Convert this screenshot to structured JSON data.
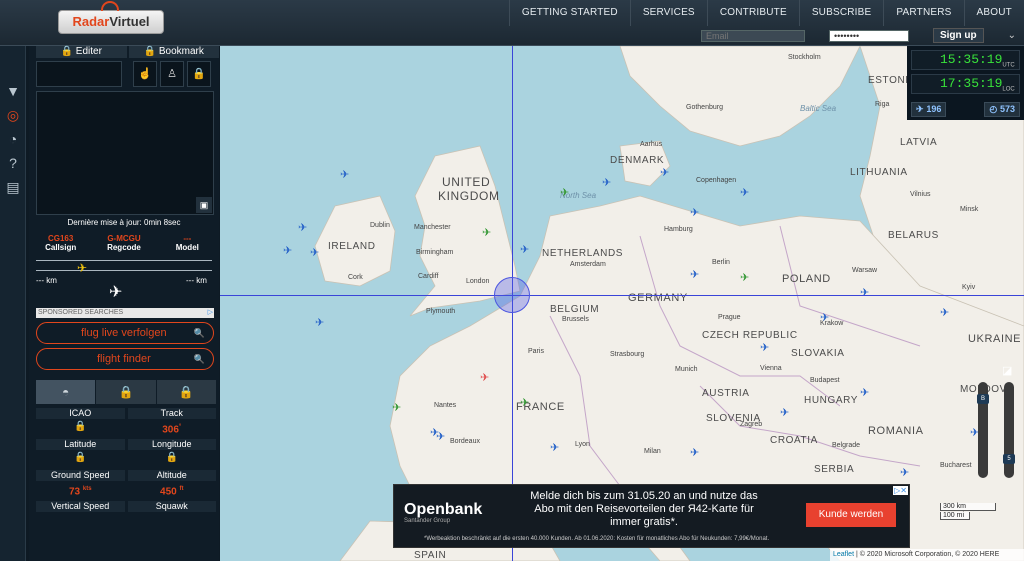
{
  "header": {
    "logo_a": "Radar",
    "logo_b": "Virtuel",
    "nav": [
      "GETTING STARTED",
      "SERVICES",
      "CONTRIBUTE",
      "SUBSCRIBE",
      "PARTNERS",
      "ABOUT"
    ],
    "email_placeholder": "Email",
    "password_value": "••••••••",
    "signup_label": "Sign up",
    "expand_icon": "double-chevron-down-icon"
  },
  "left_strip": {
    "icons": [
      "filter-icon",
      "radar-target-icon",
      "radar-sweep-icon",
      "help-icon",
      "chat-icon"
    ]
  },
  "panel": {
    "edit_label": "Editer",
    "bookmark_label": "Bookmark",
    "last_update": "Dernière mise à jour: 0min 8sec",
    "callsign_value": "CG163",
    "callsign_label": "Callsign",
    "regcode_value": "G-MCGU",
    "regcode_label": "Regcode",
    "model_value": "---",
    "model_label": "Model",
    "dist_left": "--- km",
    "dist_right": "--- km",
    "sponsored": "SPONSORED SEARCHES",
    "search1": "flug live verfolgen",
    "search2": "flight finder",
    "icao_label": "ICAO",
    "track_label": "Track",
    "track_value": "306",
    "track_unit": "°",
    "lat_label": "Latitude",
    "lon_label": "Longitude",
    "gs_label": "Ground Speed",
    "gs_value": "73",
    "gs_unit": "kts",
    "alt_label": "Altitude",
    "alt_value": "450",
    "alt_unit": "ft",
    "vs_label": "Vertical Speed",
    "squawk_label": "Squawk"
  },
  "clock": {
    "utc_time": "15:35:19",
    "utc_label": "UTC",
    "loc_time": "17:35:19",
    "loc_label": "LOC",
    "flights": "196",
    "aircraft": "573"
  },
  "map": {
    "countries": [
      "ESTONIA",
      "LATVIA",
      "LITHUANIA",
      "BELARUS",
      "UNITED",
      "KINGDOM",
      "IRELAND",
      "DENMARK",
      "NETHERLANDS",
      "BELGIUM",
      "GERMANY",
      "POLAND",
      "CZECH REPUBLIC",
      "SLOVAKIA",
      "UKRAINE",
      "AUSTRIA",
      "HUNGARY",
      "MOLDOVA",
      "FRANCE",
      "SLOVENIA",
      "CROATIA",
      "ROMANIA",
      "SERBIA",
      "SPAIN"
    ],
    "seas": [
      "Baltic Sea",
      "North Sea"
    ],
    "cities": [
      "Stockholm",
      "Gothenburg",
      "Riga",
      "Copenhagen",
      "Aarhus",
      "Vilnius",
      "Minsk",
      "Manchester",
      "Birmingham",
      "London",
      "Dublin",
      "Amsterdam",
      "Hamburg",
      "Berlin",
      "Warsaw",
      "Brussels",
      "Paris",
      "Prague",
      "Munich",
      "Vienna",
      "Budapest",
      "Krakow",
      "Kyiv",
      "Lyon",
      "Milan",
      "Bucharest",
      "Belgrade",
      "Zagreb",
      "Plymouth",
      "Cork",
      "Cardiff",
      "Nantes",
      "Bordeaux",
      "Strasbourg"
    ],
    "scale_km": "300 km",
    "scale_mi": "100 mi",
    "leaflet": "Leaflet",
    "attribution": "| © 2020 Microsoft Corporation, © 2020 HERE"
  },
  "ad": {
    "brand": "Openbank",
    "sub": "Santander Group",
    "headline": "Melde dich bis zum 31.05.20 an und nutze das Abo mit den Reisevorteilen der Я42-Karte für immer gratis*.",
    "cta": "Kunde werden",
    "footnote": "*Werbeaktion beschränkt auf die ersten 40.000 Kunden. Ab 01.06.2020: Kosten für monatliches Abo für Neukunden: 7,99€/Monat."
  }
}
